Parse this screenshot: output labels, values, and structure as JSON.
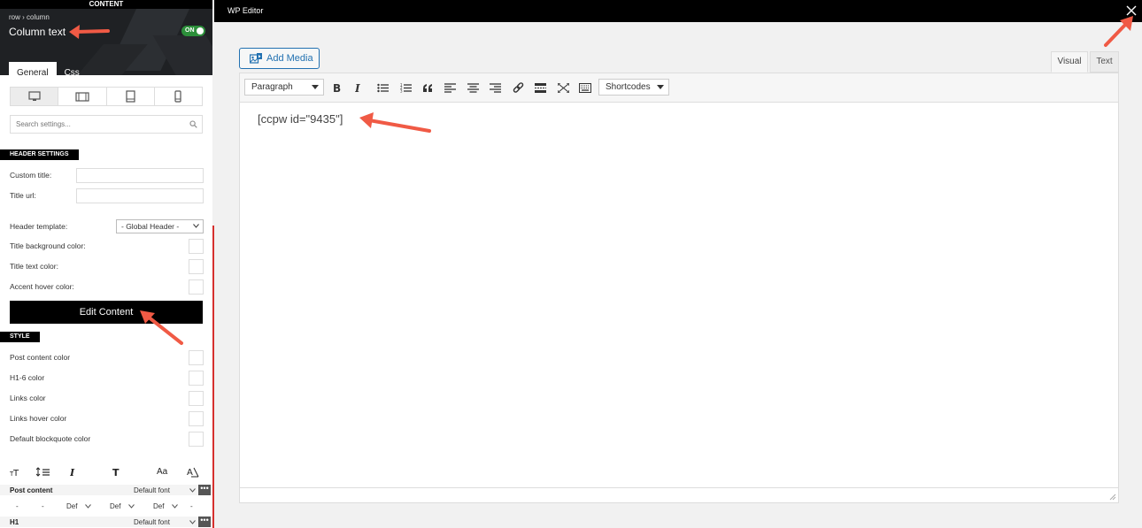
{
  "panel": {
    "top_label": "CONTENT",
    "breadcrumb": "row › column",
    "title": "Column text",
    "toggle": "ON",
    "tabs": [
      {
        "label": "General"
      },
      {
        "label": "Css"
      }
    ],
    "search_placeholder": "Search settings...",
    "header_settings": {
      "section": "HEADER SETTINGS",
      "custom_title": "Custom title:",
      "title_url": "Title url:",
      "header_template": "Header template:",
      "header_template_value": "- Global Header -",
      "title_bg_color": "Title background color:",
      "title_text_color": "Title text color:",
      "accent_hover_color": "Accent hover color:"
    },
    "edit_content": "Edit Content",
    "style": {
      "section": "STYLE",
      "post_content_color": "Post content color",
      "h16_color": "H1-6 color",
      "links_color": "Links color",
      "links_hover_color": "Links hover color",
      "blockquote_color": "Default blockquote color"
    },
    "typography": {
      "aa": "Aa",
      "rows": [
        {
          "name": "Post content",
          "font": "Default font"
        },
        {
          "name": "H1",
          "font": "Default font"
        }
      ],
      "dash": "-",
      "def": "Def"
    }
  },
  "editor": {
    "title": "WP Editor",
    "add_media": "Add Media",
    "tabs": {
      "visual": "Visual",
      "text": "Text"
    },
    "format": "Paragraph",
    "shortcodes": "Shortcodes",
    "content": "[ccpw id=\"9435\"]"
  },
  "colors": {
    "accent": "#2271b1",
    "arrow": "#f05a45",
    "toggle": "#2c8f3a",
    "divider": "#d6302e"
  }
}
